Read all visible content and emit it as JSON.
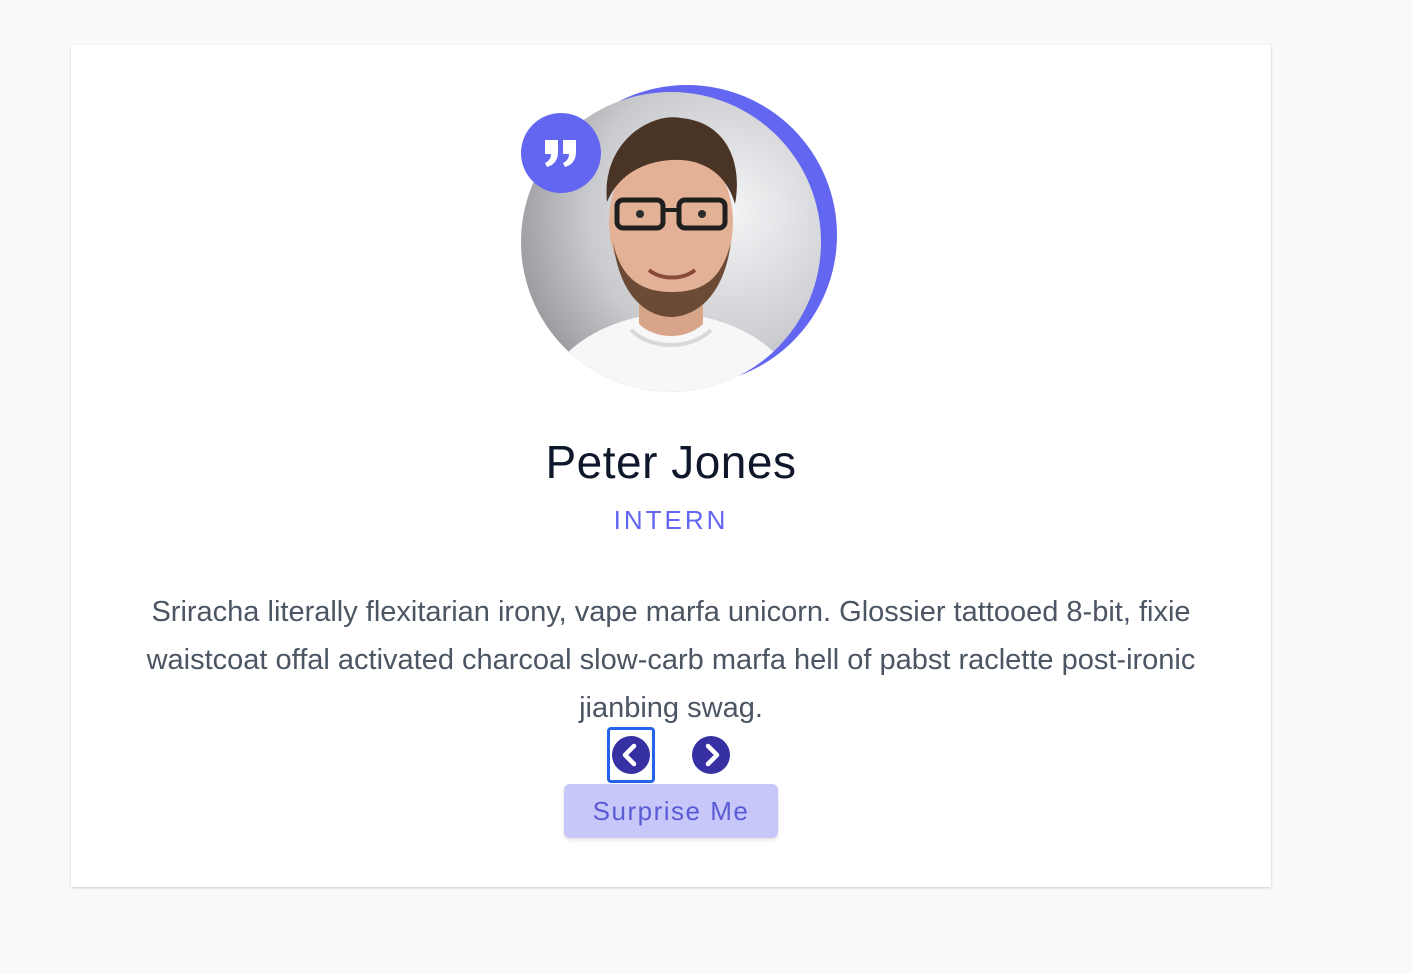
{
  "review": {
    "name": "Peter Jones",
    "job": "INTERN",
    "text": "Sriracha literally flexitarian irony, vape marfa unicorn. Glossier tattooed 8-bit, fixie waistcoat offal activated charcoal slow-carb marfa hell of pabst raclette post-ironic jianbing swag."
  },
  "buttons": {
    "prev_icon": "chevron-left-icon",
    "next_icon": "chevron-right-icon",
    "random_label": "Surprise Me"
  },
  "colors": {
    "accent": "#6366f1",
    "nav_button": "#3730a3",
    "focus_outline": "#2563eb",
    "surprise_bg": "#c7c7fa"
  },
  "icons": {
    "quote": "quote-right-icon"
  }
}
